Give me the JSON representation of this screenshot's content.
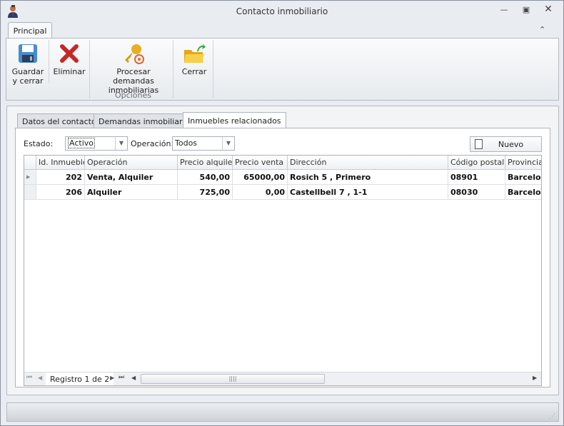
{
  "window": {
    "title": "Contacto inmobiliario"
  },
  "ribbon": {
    "tab": "Principal",
    "buttons": [
      {
        "label": "Guardar y cerrar"
      },
      {
        "label": "Eliminar"
      },
      {
        "label": "Procesar demandas inmobiliarias"
      },
      {
        "label": "Cerrar"
      }
    ],
    "group_label": "Opciones"
  },
  "tabs": [
    "Datos del contacto",
    "Demandas inmobiliarias",
    "Inmuebles relacionados"
  ],
  "filters": {
    "estado_label": "Estado:",
    "estado_value": "Activo",
    "operacion_label": "Operación:",
    "operacion_value": "Todos",
    "new_button": "Nuevo"
  },
  "grid": {
    "columns": [
      "Id. Inmueble",
      "Operación",
      "Precio alquiler",
      "Precio venta",
      "Dirección",
      "Código postal",
      "Provincia"
    ],
    "rows": [
      [
        "202",
        "Venta, Alquiler",
        "540,00",
        "65000,00",
        "Rosich 5 , Primero",
        "08901",
        "Barcelona"
      ],
      [
        "206",
        "Alquiler",
        "725,00",
        "0,00",
        "Castellbell 7 , 1-1",
        "08030",
        "Barcelona"
      ]
    ],
    "navigator": "Registro 1 de 2"
  }
}
